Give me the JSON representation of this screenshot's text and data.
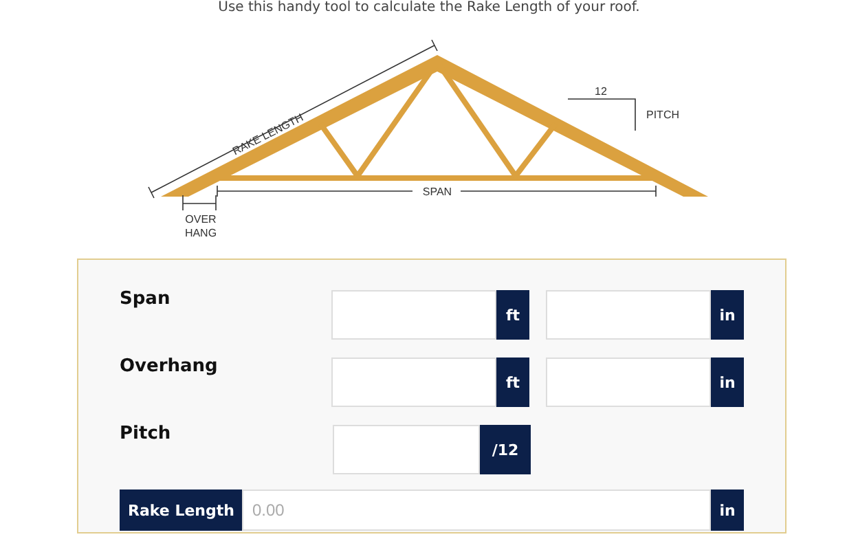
{
  "intro": "Use this handy tool to calculate the Rake Length of your roof.",
  "diagram": {
    "rake_label": "RAKE LENGTH",
    "span_label": "SPAN",
    "overhang_label": [
      "OVER",
      "HANG"
    ],
    "pitch_run": "12",
    "pitch_label": "PITCH"
  },
  "form": {
    "rows": [
      {
        "label": "Span",
        "inputs": [
          {
            "unit": "ft"
          },
          {
            "unit": "in"
          }
        ]
      },
      {
        "label": "Overhang",
        "inputs": [
          {
            "unit": "ft"
          },
          {
            "unit": "in"
          }
        ]
      },
      {
        "label": "Pitch",
        "inputs": [
          {
            "unit": "/12"
          }
        ]
      }
    ],
    "result": {
      "label": "Rake Length",
      "placeholder": "0.00",
      "unit": "in"
    }
  }
}
